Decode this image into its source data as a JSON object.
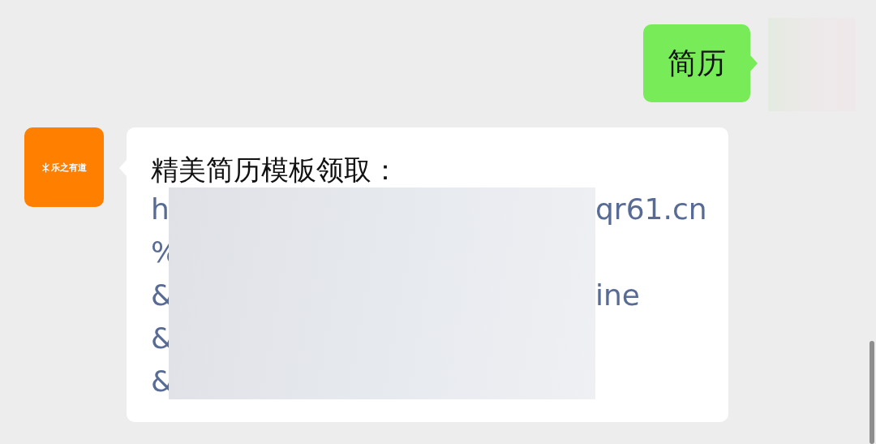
{
  "messages": [
    {
      "sent": true,
      "kind": "text",
      "text": "简历"
    },
    {
      "sent": false,
      "kind": "link",
      "sender_logo": "乐之有道",
      "title": "精美简历模板领取：",
      "lines": [
        {
          "left": "h",
          "right": "qr61.cn"
        },
        {
          "left": "%"
        },
        {
          "left": "&",
          "right": "ine"
        },
        {
          "left": "&"
        },
        {
          "left": "&"
        }
      ]
    }
  ]
}
